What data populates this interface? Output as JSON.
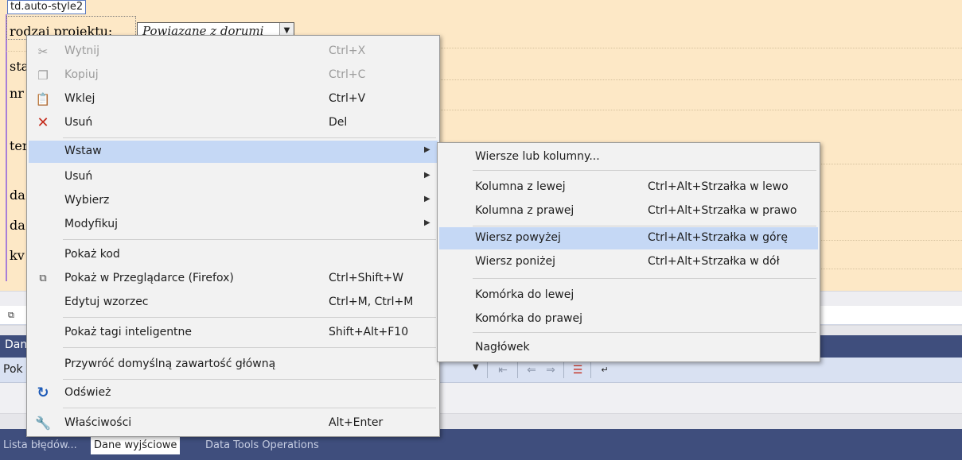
{
  "designer": {
    "tag_hint": "td.auto-style2",
    "labels": [
      "rodzaj projektu:",
      "sta",
      "nr",
      "ter",
      "da",
      "da",
      "kv"
    ],
    "select_value": "Powiązane z dorumi"
  },
  "icons": {
    "cut": "scissors-icon",
    "copy": "copy-icon",
    "paste": "clipboard-icon",
    "delete": "red-x-icon",
    "browser": "browser-window-icon",
    "refresh": "refresh-icon",
    "properties": "wrench-icon"
  },
  "colors": {
    "menu_bg": "#f2f2f2",
    "highlight": "#c5d8f5",
    "delete_red": "#c42b1c",
    "refresh_blue": "#1f5cb8",
    "panel_title_bg": "#3f4e7d"
  },
  "context_menu": {
    "items": [
      {
        "label": "Wytnij",
        "shortcut": "Ctrl+X",
        "disabled": true
      },
      {
        "label": "Kopiuj",
        "shortcut": "Ctrl+C",
        "disabled": true
      },
      {
        "label": "Wklej",
        "shortcut": "Ctrl+V"
      },
      {
        "label": "Usuń",
        "shortcut": "Del"
      },
      {
        "label": "Wstaw",
        "highlighted": true,
        "submenu": true
      },
      {
        "label": "Usuń",
        "submenu": true
      },
      {
        "label": "Wybierz",
        "submenu": true
      },
      {
        "label": "Modyfikuj",
        "submenu": true
      },
      {
        "label": "Pokaż kod"
      },
      {
        "label": "Pokaż w Przeglądarce (Firefox)",
        "shortcut": "Ctrl+Shift+W"
      },
      {
        "label": "Edytuj wzorzec",
        "shortcut": "Ctrl+M, Ctrl+M"
      },
      {
        "label": "Pokaż tagi inteligentne",
        "shortcut": "Shift+Alt+F10"
      },
      {
        "label": "Przywróć domyślną zawartość główną"
      },
      {
        "label": "Odśwież"
      },
      {
        "label": "Właściwości",
        "shortcut": "Alt+Enter"
      }
    ]
  },
  "submenu": {
    "items": [
      {
        "label": "Wiersze lub kolumny..."
      },
      {
        "label": "Kolumna z lewej",
        "shortcut": "Ctrl+Alt+Strzałka w lewo"
      },
      {
        "label": "Kolumna z prawej",
        "shortcut": "Ctrl+Alt+Strzałka w prawo"
      },
      {
        "label": "Wiersz powyżej",
        "shortcut": "Ctrl+Alt+Strzałka w górę",
        "highlighted": true
      },
      {
        "label": "Wiersz poniżej",
        "shortcut": "Ctrl+Alt+Strzałka w dół"
      },
      {
        "label": "Komórka do lewej"
      },
      {
        "label": "Komórka do prawej"
      },
      {
        "label": "Nagłówek"
      }
    ]
  },
  "output_panel": {
    "title": "Dan",
    "toolbar_label": "Pok"
  },
  "bottom_tabs": {
    "errors": "Lista błędów...",
    "output": "Dane wyjściowe",
    "data_tools": "Data Tools Operations"
  }
}
